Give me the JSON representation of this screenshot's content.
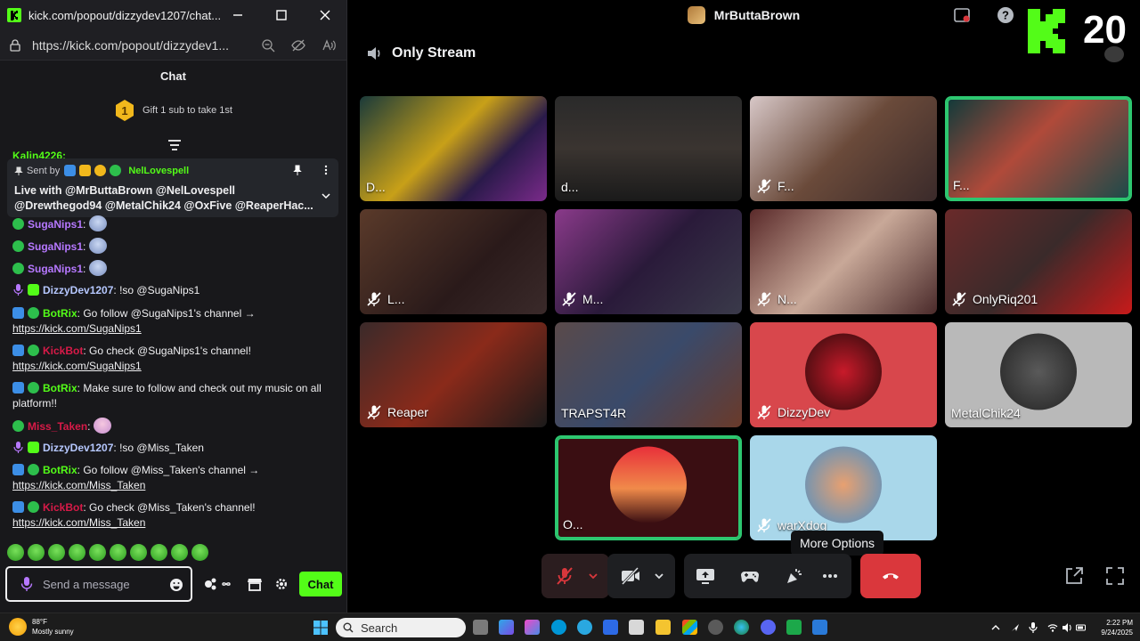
{
  "browser": {
    "title": "kick.com/popout/dizzydev1207/chat...",
    "url": "https://kick.com/popout/dizzydev1...",
    "accent": "#53fc18"
  },
  "kick_chat": {
    "header": "Chat",
    "gift_badge_number": "1",
    "gift_text": "Gift 1 sub to take 1st",
    "peek_user": "Kalin4226:",
    "pinned": {
      "sent_by_label": "Sent by",
      "sender": "NelLovespell",
      "message": "Live with @MrButtaBrown @NelLovespell @Drewthegod94 @MetalChik24 @OxFive @ReaperHac..."
    },
    "messages": [
      {
        "user": "SugaNips1",
        "sep": ":",
        "text": "",
        "color": "#b678ff"
      },
      {
        "user": "SugaNips1",
        "sep": ":",
        "text": "",
        "color": "#b678ff"
      },
      {
        "user": "SugaNips1",
        "sep": ":",
        "text": "",
        "color": "#b678ff"
      },
      {
        "user": "DizzyDev1207",
        "sep": ":",
        "text": " !so @SugaNips1",
        "color": "#b6c8ff"
      },
      {
        "user": "BotRix",
        "sep": ":",
        "text": " Go follow @SugaNips1's channel →",
        "link": "https://kick.com/SugaNips1",
        "color": "#53fc18"
      },
      {
        "user": "KickBot",
        "sep": ":",
        "text": " Go check @SugaNips1's channel!",
        "link": "https://kick.com/SugaNips1",
        "color": "#d81a48"
      },
      {
        "user": "BotRix",
        "sep": ":",
        "text": " Make sure to follow and check out my music on all platform!!",
        "color": "#53fc18"
      },
      {
        "user": "Miss_Taken",
        "sep": ":",
        "text": "",
        "color": "#d81a48"
      },
      {
        "user": "DizzyDev1207",
        "sep": ":",
        "text": " !so @Miss_Taken",
        "color": "#b6c8ff"
      },
      {
        "user": "BotRix",
        "sep": ":",
        "text": " Go follow @Miss_Taken's channel →",
        "link": "https://kick.com/Miss_Taken",
        "color": "#53fc18"
      },
      {
        "user": "KickBot",
        "sep": ":",
        "text": " Go check @Miss_Taken's channel!",
        "link": "https://kick.com/Miss_Taken",
        "color": "#d81a48"
      }
    ],
    "input_placeholder": "Send a message",
    "send_label": "Chat"
  },
  "discord": {
    "window_title": "MrButtaBrown",
    "overlay_number": "20",
    "channel_name": "Only Stream",
    "participants": [
      {
        "label": "D...",
        "muted": false,
        "bg": "linear-gradient(135deg,#1a3a3a,#c8a018 45%,#2a1a4a 70%,#7a2a8a)",
        "speaking": false
      },
      {
        "label": "d...",
        "muted": false,
        "bg": "linear-gradient(180deg,#2a2a2a,#3a3430 50%,#1a1a1a)",
        "speaking": false
      },
      {
        "label": "F...",
        "muted": true,
        "bg": "linear-gradient(135deg,#d8c8c8,#6a4a3a 50%,#3a2a2a)",
        "speaking": false
      },
      {
        "label": "F...",
        "muted": false,
        "bg": "linear-gradient(135deg,#0f3a3a,#b04a3a 45%,#1a4a4a)",
        "speaking": true
      },
      {
        "label": "L...",
        "muted": true,
        "bg": "linear-gradient(135deg,#5a3a2a,#2a1a1a 60%,#3a2a2a)",
        "speaking": false
      },
      {
        "label": "M...",
        "muted": true,
        "bg": "linear-gradient(135deg,#8a3a8a,#2a1a3a 50%,#3a3a4a)",
        "speaking": false
      },
      {
        "label": "N...",
        "muted": true,
        "bg": "linear-gradient(135deg,#5a2a2a,#c8a898 50%,#4a2a2a)",
        "speaking": false
      },
      {
        "label": "OnlyRiq201",
        "muted": true,
        "bg": "linear-gradient(135deg,#6a2a2a,#3a2a2a 50%,#c81a1a)",
        "speaking": false
      },
      {
        "label": "Reaper",
        "muted": true,
        "bg": "linear-gradient(135deg,#3a2a2a,#8a2a1a 50%,#1a1a1a)",
        "speaking": false
      },
      {
        "label": "TRAPST4R",
        "muted": false,
        "bg": "linear-gradient(135deg,#5a4a4a,#3a4a6a 50%,#6a3a2a)",
        "speaking": false
      },
      {
        "label": "DizzyDev",
        "muted": true,
        "bg": "#d8474c",
        "logo": "radial-gradient(circle,#c81a2a,#2a0a0a)",
        "speaking": false
      },
      {
        "label": "MetalChik24",
        "muted": false,
        "bg": "#b9b9b9",
        "logo": "radial-gradient(circle,#5a5a5a,#222)",
        "speaking": false
      },
      {
        "label": "O...",
        "muted": false,
        "bg": "#3a0e12",
        "logo": "linear-gradient(180deg,#e8303a,#f08a4a 55%,#3a0e12)",
        "speaking": true
      },
      {
        "label": "warXdog",
        "muted": true,
        "bg": "#a9d7ea",
        "logo": "radial-gradient(circle,#e8a070,#4a90c8)",
        "speaking": false
      }
    ],
    "tooltip": "More Options",
    "accent": "#2dc770",
    "danger": "#da373c"
  },
  "taskbar": {
    "weather_temp": "88°F",
    "weather_desc": "Mostly sunny",
    "search_placeholder": "Search",
    "time": "2:22 PM",
    "date": "9/24/2025"
  }
}
